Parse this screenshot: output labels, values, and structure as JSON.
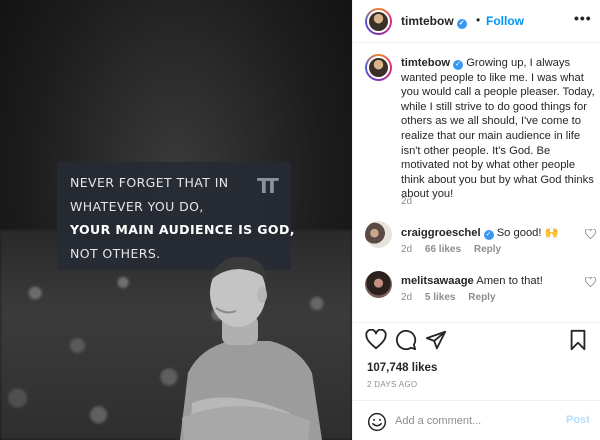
{
  "image": {
    "quote_lines": [
      "NEVER FORGET THAT IN",
      "WHATEVER YOU DO,",
      "YOUR MAIN AUDIENCE IS GOD,",
      "NOT OTHERS."
    ],
    "logo_text": "TT"
  },
  "header": {
    "username": "timtebow",
    "verified_glyph": "✓",
    "separator": "•",
    "follow_label": "Follow",
    "more_glyph": "•••"
  },
  "caption": {
    "username": "timtebow",
    "text": "Growing up, I always wanted people to like me. I was what you would call a people pleaser. Today, while I still strive to do good things for others as we all should, I've come to realize that our main audience in life isn't other people. It's God. Be motivated not by what other people think about you but by what God thinks about you!",
    "time": "2d"
  },
  "comments": [
    {
      "username": "craiggroeschel",
      "verified": true,
      "text": "So good! 🙌",
      "time": "2d",
      "likes": "66 likes",
      "reply": "Reply"
    },
    {
      "username": "melitsawaage",
      "verified": false,
      "text": "Amen to that!",
      "time": "2d",
      "likes": "5 likes",
      "reply": "Reply"
    }
  ],
  "actions": {
    "icons": [
      "heart-icon",
      "comment-icon",
      "share-icon",
      "bookmark-icon"
    ]
  },
  "likes_count": "107,748 likes",
  "post_date": "2 DAYS AGO",
  "add_comment": {
    "placeholder": "Add a comment...",
    "post_label": "Post"
  },
  "colors": {
    "link_blue": "#0095f6",
    "post_disabled": "#b2dffc",
    "verified": "#3897f0",
    "muted": "#8e8e8e"
  }
}
